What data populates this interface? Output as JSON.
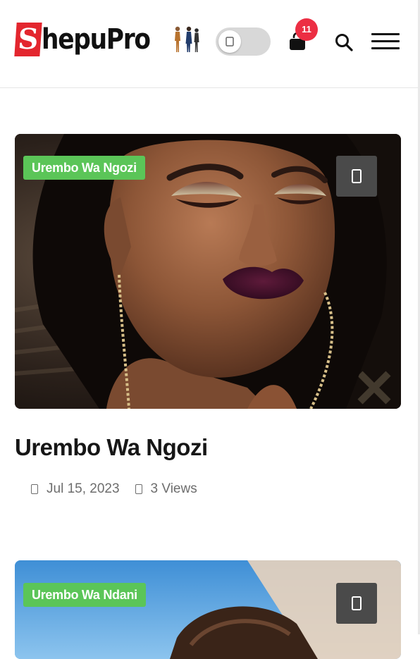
{
  "header": {
    "logo_first_letter": "S",
    "logo_rest": "hepuPro",
    "cart_count": "11"
  },
  "posts": [
    {
      "category": "Urembo Wa Ngozi",
      "title": "Urembo Wa Ngozi",
      "date": "Jul 15, 2023",
      "views": "3 Views"
    },
    {
      "category": "Urembo Wa Ndani"
    }
  ],
  "colors": {
    "brand_red": "#e3262e",
    "category_green": "#5bc558",
    "badge_red": "#ec2e43"
  }
}
